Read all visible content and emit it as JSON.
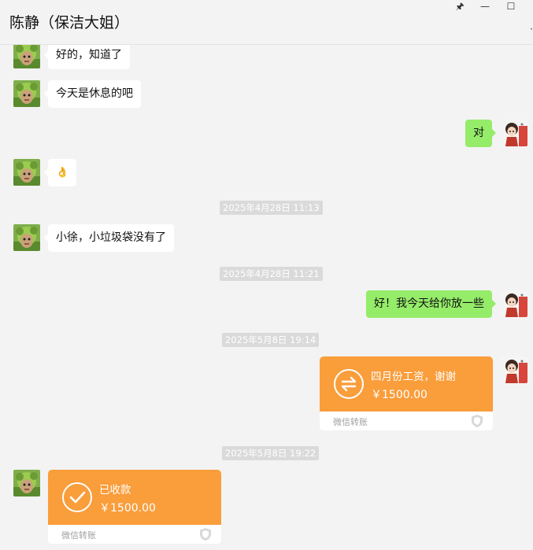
{
  "window": {
    "title": "陈静（保洁大姐）",
    "controls": {
      "pin": "🖈",
      "minimize": "—",
      "maximize": "☐",
      "more": "·"
    }
  },
  "messages": {
    "m1": "好的，知道了",
    "m2": "今天是休息的吧",
    "m3": "对",
    "m4": "👌",
    "ts1": "2025年4月28日 11:13",
    "m5": "小徐，小垃圾袋没有了",
    "ts2": "2025年4月28日 11:21",
    "m6": "好！我今天给你放一些",
    "ts3": "2025年5月8日 19:14",
    "ts4": "2025年5月8日 19:22"
  },
  "transfers": {
    "sent": {
      "title": "四月份工资，谢谢",
      "amount": "￥1500.00",
      "source": "微信转账"
    },
    "received": {
      "title": "已收款",
      "amount": "￥1500.00",
      "source": "微信转账"
    }
  },
  "colors": {
    "background": "#f3f3f3",
    "incoming_bubble": "#ffffff",
    "outgoing_bubble": "#95ec69",
    "transfer_orange": "#fa9d3b",
    "timestamp_bg": "#dadada"
  },
  "icons": {
    "contact_avatar": "cartoon-avatar-green",
    "self_avatar": "cartoon-avatar-red",
    "transfer_sent": "transfer-arrows-icon",
    "transfer_received": "checkmark-icon",
    "shield": "shield-icon"
  }
}
